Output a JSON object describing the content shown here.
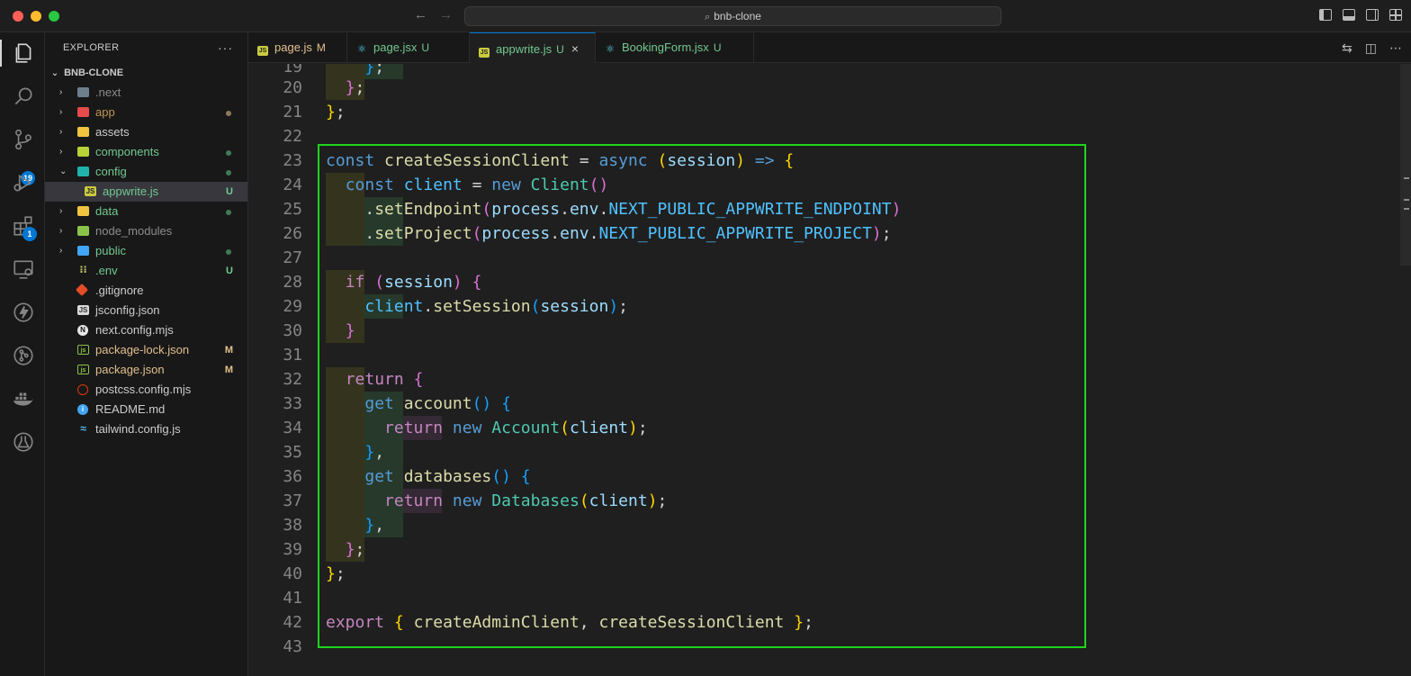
{
  "window": {
    "search_text": "bnb-clone"
  },
  "activity_bar": {
    "source_control_badge": "19",
    "extensions_badge": "1"
  },
  "explorer": {
    "title": "EXPLORER",
    "more_label": "···",
    "root": "BNB-CLONE",
    "items": [
      {
        "name": ".next",
        "type": "folder",
        "status": ""
      },
      {
        "name": "app",
        "type": "folder",
        "status": "dot"
      },
      {
        "name": "assets",
        "type": "folder",
        "status": ""
      },
      {
        "name": "components",
        "type": "folder",
        "status": "dot"
      },
      {
        "name": "config",
        "type": "folder",
        "status": "dot"
      },
      {
        "name": "appwrite.js",
        "type": "file",
        "status": "U"
      },
      {
        "name": "data",
        "type": "folder",
        "status": "dot"
      },
      {
        "name": "node_modules",
        "type": "folder",
        "status": ""
      },
      {
        "name": "public",
        "type": "folder",
        "status": "dot"
      },
      {
        "name": ".env",
        "type": "file",
        "status": "U"
      },
      {
        "name": ".gitignore",
        "type": "file",
        "status": ""
      },
      {
        "name": "jsconfig.json",
        "type": "file",
        "status": ""
      },
      {
        "name": "next.config.mjs",
        "type": "file",
        "status": ""
      },
      {
        "name": "package-lock.json",
        "type": "file",
        "status": "M"
      },
      {
        "name": "package.json",
        "type": "file",
        "status": "M"
      },
      {
        "name": "postcss.config.mjs",
        "type": "file",
        "status": ""
      },
      {
        "name": "README.md",
        "type": "file",
        "status": ""
      },
      {
        "name": "tailwind.config.js",
        "type": "file",
        "status": ""
      }
    ]
  },
  "tabs": [
    {
      "label": "page.js",
      "status": "M"
    },
    {
      "label": "page.jsx",
      "status": "U"
    },
    {
      "label": "appwrite.js",
      "status": "U",
      "close": "×"
    },
    {
      "label": "BookingForm.jsx",
      "status": "U"
    }
  ],
  "editor": {
    "line_numbers": [
      "19",
      "20",
      "21",
      "22",
      "23",
      "24",
      "25",
      "26",
      "27",
      "28",
      "29",
      "30",
      "31",
      "32",
      "33",
      "34",
      "35",
      "36",
      "37",
      "38",
      "39",
      "40",
      "41",
      "42",
      "43"
    ],
    "lines": [
      "    };",
      "  };",
      "};",
      "",
      "const createSessionClient = async (session) => {",
      "  const client = new Client()",
      "    .setEndpoint(process.env.NEXT_PUBLIC_APPWRITE_ENDPOINT)",
      "    .setProject(process.env.NEXT_PUBLIC_APPWRITE_PROJECT);",
      "",
      "  if (session) {",
      "    client.setSession(session);",
      "  }",
      "",
      "  return {",
      "    get account() {",
      "      return new Account(client);",
      "    },",
      "    get databases() {",
      "      return new Databases(client);",
      "    },",
      "  };",
      "};",
      "",
      "export { createAdminClient, createSessionClient };",
      ""
    ]
  },
  "colors": {
    "accent": "#0078d4",
    "highlight_border": "#1ed51e",
    "modified": "#e2c08d",
    "untracked": "#73c991"
  }
}
